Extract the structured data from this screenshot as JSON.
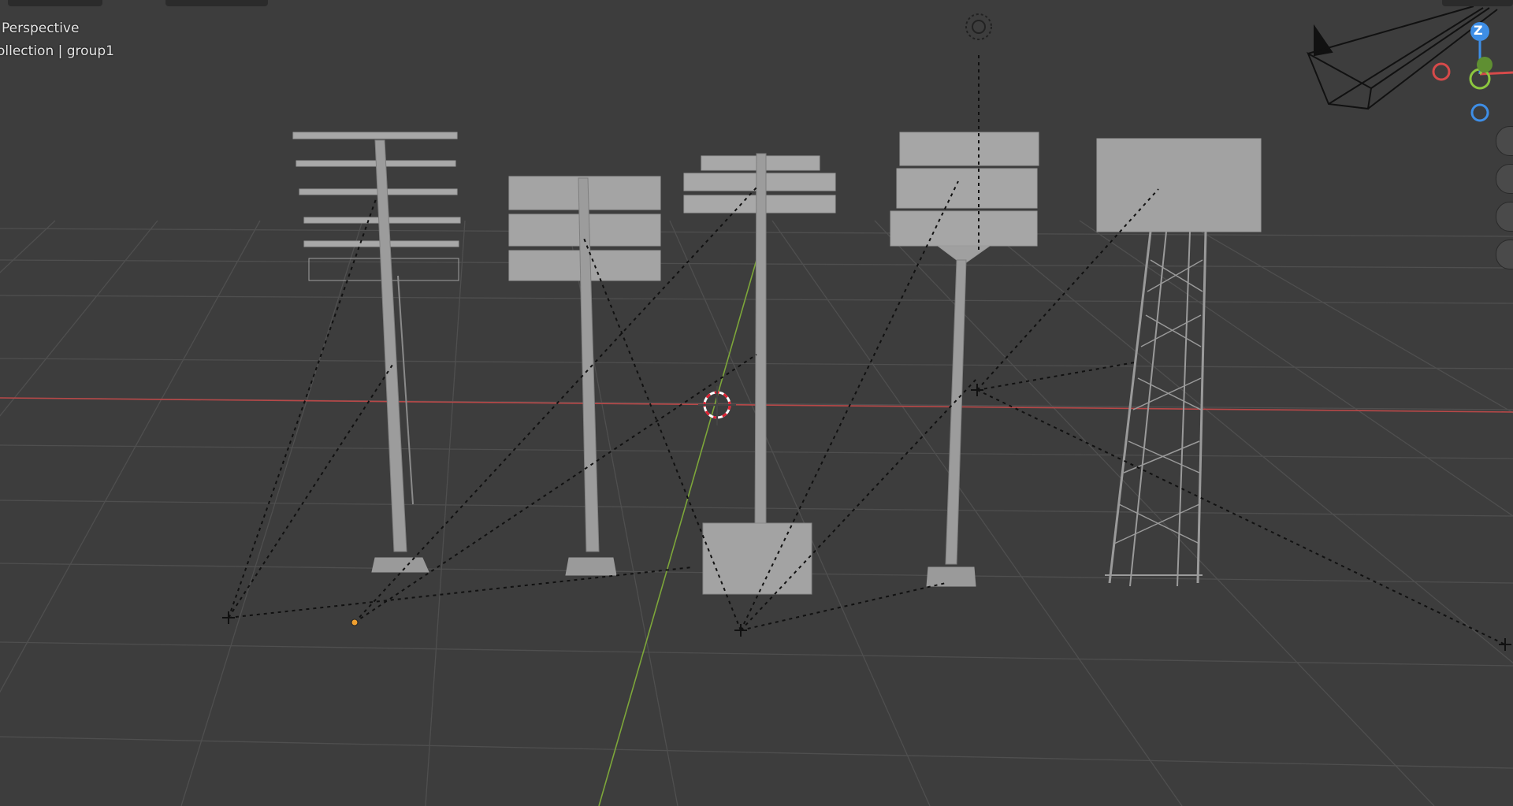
{
  "viewport": {
    "view_mode": "Perspective",
    "collection_label": "ollection | group1"
  },
  "gizmo": {
    "z_label": "Z",
    "colors": {
      "x": "#d64a4a",
      "y": "#8cc63f",
      "z": "#3e8ee6"
    }
  },
  "nav_buttons": [
    "zoom-icon",
    "hand-pan-icon",
    "camera-icon",
    "ortho-grid-icon"
  ],
  "scene_objects": [
    {
      "name": "light-tower-1",
      "type": "pole-round-lamps"
    },
    {
      "name": "light-tower-2",
      "type": "pole-box-lamps"
    },
    {
      "name": "light-tower-3",
      "type": "pole-on-block"
    },
    {
      "name": "light-tower-4",
      "type": "pole-large-panel"
    },
    {
      "name": "light-tower-5",
      "type": "lattice-tower"
    }
  ]
}
